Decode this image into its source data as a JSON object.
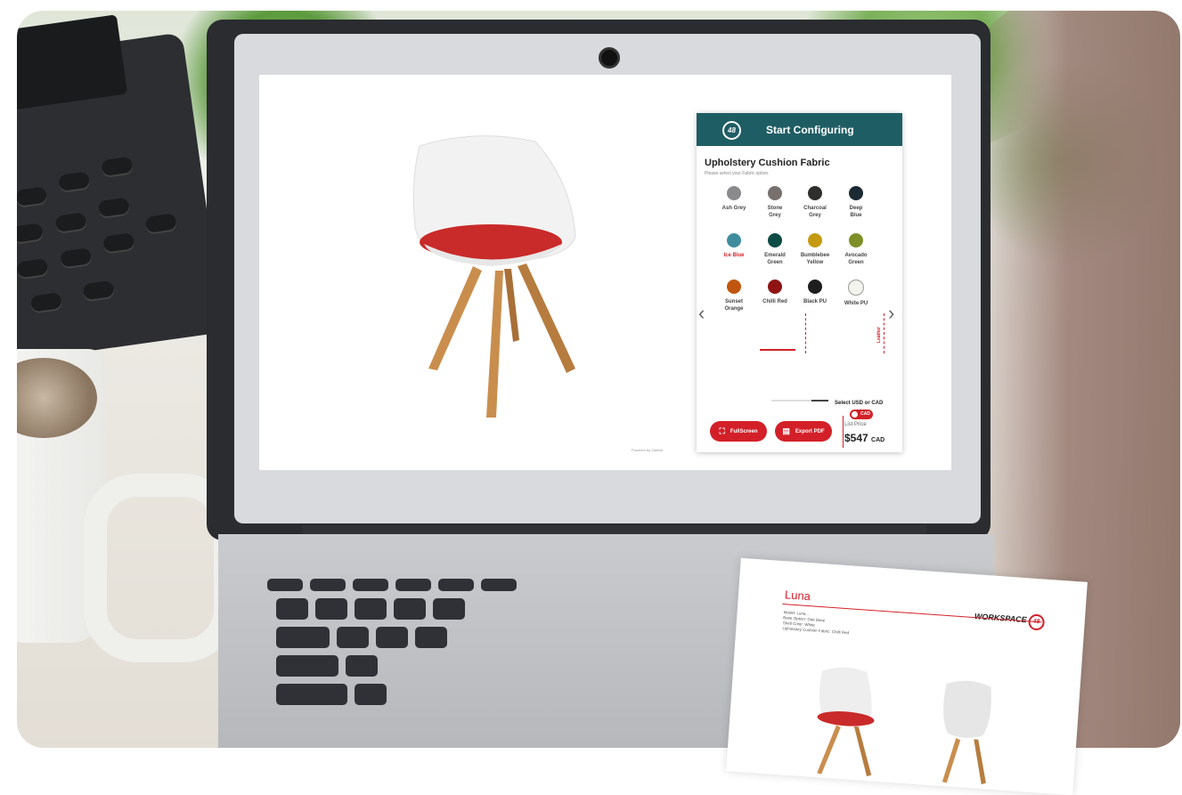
{
  "configurator": {
    "header_title": "Start Configuring",
    "logo_text": "48",
    "section_title": "Upholstery Cushion Fabric",
    "section_subtitle": "Please select your Fabric option.",
    "swatches": [
      {
        "label1": "Ash Grey",
        "label2": "",
        "color": "#8a8a8c",
        "selected": false
      },
      {
        "label1": "Stone",
        "label2": "Grey",
        "color": "#77706f",
        "selected": false
      },
      {
        "label1": "Charcoal",
        "label2": "Grey",
        "color": "#2e2f2d",
        "selected": false
      },
      {
        "label1": "Deep",
        "label2": "Blue",
        "color": "#1b2a33",
        "selected": false
      },
      {
        "label1": "Ice Blue",
        "label2": "",
        "color": "#3f8c9d",
        "selected": false,
        "highlight": true
      },
      {
        "label1": "Emerald",
        "label2": "Green",
        "color": "#0d4b45",
        "selected": false
      },
      {
        "label1": "Bumblebee",
        "label2": "Yellow",
        "color": "#c59a12",
        "selected": false
      },
      {
        "label1": "Avocado",
        "label2": "Green",
        "color": "#7f8f28",
        "selected": false
      },
      {
        "label1": "Sunset",
        "label2": "Orange",
        "color": "#c0560e",
        "selected": false
      },
      {
        "label1": "Chilli Red",
        "label2": "",
        "color": "#8e1414",
        "selected": true
      },
      {
        "label1": "Black PU",
        "label2": "",
        "color": "#1e1e1e",
        "selected": false
      },
      {
        "label1": "White PU",
        "label2": "",
        "color": "#f4f4ee",
        "selected": false
      }
    ],
    "leather_label": "Leather",
    "prev_arrow": "‹",
    "next_arrow": "›",
    "currency_label": "Select USD or CAD",
    "currency_value": "CAD",
    "fullscreen_label": "FullScreen",
    "export_label": "Export PDF",
    "list_price_label": "List Price",
    "price": "$547",
    "price_currency": "CAD",
    "progress": 0.3,
    "colors": {
      "header": "#1f5d64",
      "accent": "#d32028"
    }
  },
  "pdf": {
    "title": "Luna",
    "brand": "WORKSPACE",
    "brand_num": "48",
    "specs": [
      "Model: Luna...",
      "Base Option: Oak Base",
      "Shell Color: White",
      "Upholstery Cushion Fabric: Chilli Red"
    ]
  },
  "viewer": {
    "powered_by": "Powered by Zakeke"
  }
}
